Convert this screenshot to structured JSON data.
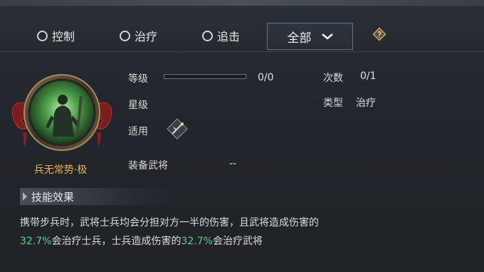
{
  "filters": {
    "options": [
      "控制",
      "治疗",
      "追击"
    ],
    "dropdown_value": "全部"
  },
  "skill": {
    "name": "兵无常势·极",
    "level_label": "等级",
    "level_value": "0/0",
    "level_progress": 0,
    "star_label": "星级",
    "apply_label": "适用",
    "equip_label": "装备武将",
    "equip_value": "--",
    "count_label": "次数",
    "count_value": "0/1",
    "type_label": "类型",
    "type_value": "治疗"
  },
  "effect": {
    "title": "技能效果",
    "line1": "携带步兵时，武将士兵均会分担对方一半的伤害，且武将造成伤害的",
    "pct1": "32.7%",
    "mid": "会治疗士兵，士兵造成伤害的",
    "pct2": "32.7%",
    "end": "会治疗武将"
  },
  "colors": {
    "accent_gold": "#e8b44a",
    "highlight_green": "#5fd08a"
  }
}
